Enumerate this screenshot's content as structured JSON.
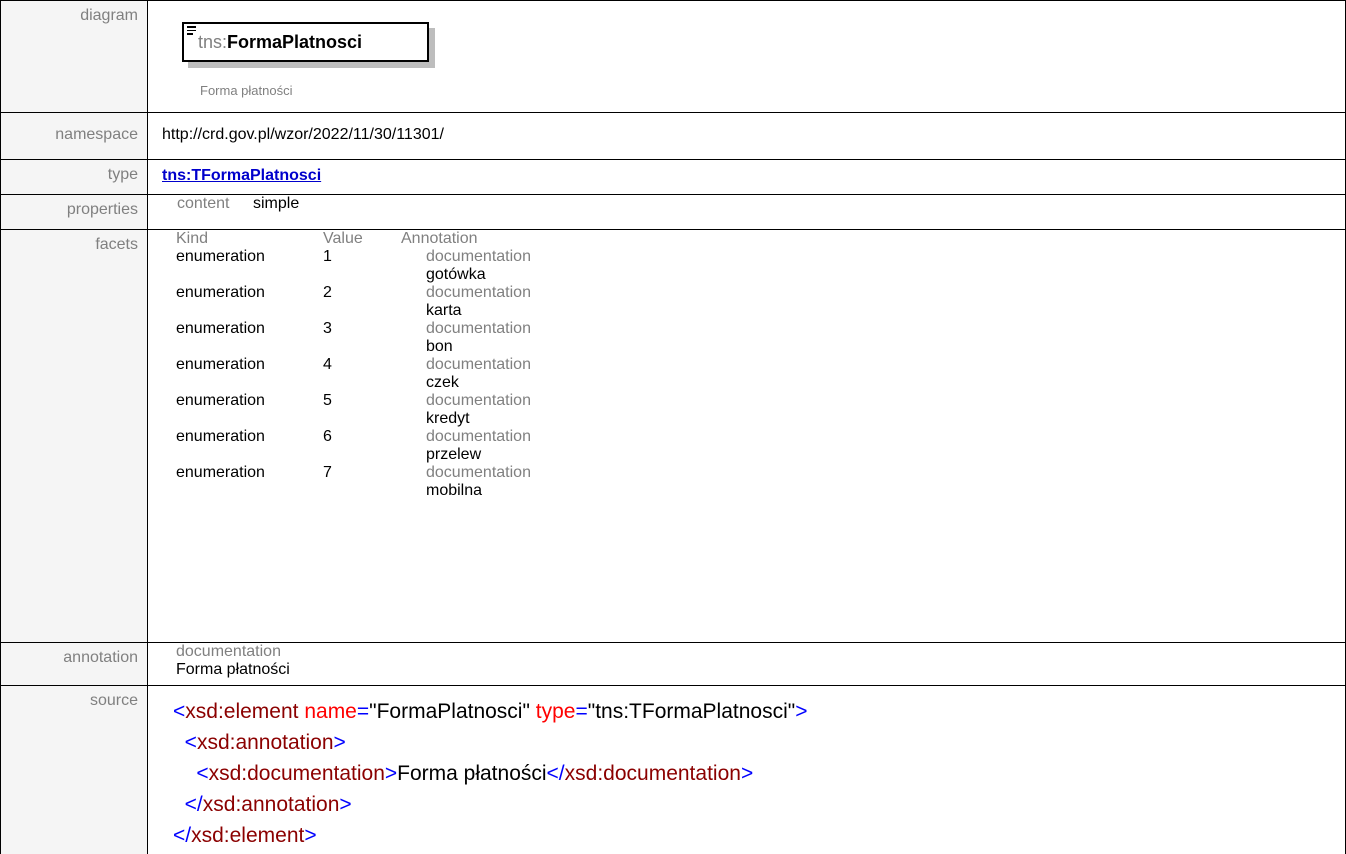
{
  "labels": {
    "diagram": "diagram",
    "namespace": "namespace",
    "type": "type",
    "properties": "properties",
    "facets": "facets",
    "annotation": "annotation",
    "source": "source"
  },
  "diagram": {
    "prefix": "tns:",
    "name": "FormaPlatnosci",
    "documentation": "Forma płatności"
  },
  "namespace": "http://crd.gov.pl/wzor/2022/11/30/11301/",
  "type": "tns:TFormaPlatnosci",
  "properties": {
    "key": "content",
    "value": "simple"
  },
  "facets": {
    "headers": [
      "Kind",
      "Value",
      "Annotation"
    ],
    "rows": [
      {
        "kind": "enumeration",
        "value": "1",
        "doc_label": "documentation",
        "doc": "gotówka"
      },
      {
        "kind": "enumeration",
        "value": "2",
        "doc_label": "documentation",
        "doc": "karta"
      },
      {
        "kind": "enumeration",
        "value": "3",
        "doc_label": "documentation",
        "doc": "bon"
      },
      {
        "kind": "enumeration",
        "value": "4",
        "doc_label": "documentation",
        "doc": "czek"
      },
      {
        "kind": "enumeration",
        "value": "5",
        "doc_label": "documentation",
        "doc": "kredyt"
      },
      {
        "kind": "enumeration",
        "value": "6",
        "doc_label": "documentation",
        "doc": "przelew"
      },
      {
        "kind": "enumeration",
        "value": "7",
        "doc_label": "documentation",
        "doc": "mobilna"
      }
    ]
  },
  "annotation": {
    "label": "documentation",
    "text": "Forma płatności"
  },
  "source": {
    "open_lt": "<",
    "close_gt": ">",
    "end_lt": "</",
    "element_tag": "xsd:element",
    "name_attr": " name",
    "eq": "=",
    "name_value": "\"FormaPlatnosci\"",
    "type_attr": " type",
    "type_value": "\"tns:TFormaPlatnosci\"",
    "annotation_tag": "xsd:annotation",
    "documentation_tag": "xsd:documentation",
    "documentation_text": "Forma płatności"
  },
  "colors": {
    "tag": "#8b0000",
    "bracket": "#0000ff",
    "attribute": "#ff0000",
    "link": "#0000cc",
    "label": "#808080"
  }
}
